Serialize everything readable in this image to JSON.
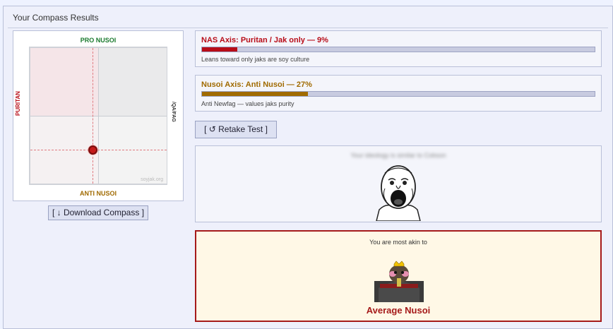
{
  "panel": {
    "title": "Your Compass Results"
  },
  "compass": {
    "top_label": "PRO NUSOI",
    "bottom_label": "ANTI NUSOI",
    "left_label": "PURITAN",
    "right_label": "/QA/FAG",
    "watermark": "soyjak.org",
    "marker_color": "#c41a1a"
  },
  "download_button": {
    "label": "[ ↓ Download Compass ]"
  },
  "nas_axis": {
    "title": "NAS Axis: Puritan / Jak only — 9%",
    "percent": 9,
    "color": "#b80d18",
    "description": "Leans toward only jaks are soy culture"
  },
  "nusoi_axis": {
    "title": "Nusoi Axis: Anti Nusoi — 27%",
    "percent": 27,
    "color": "#a06a00",
    "description": "Anti Newfag — values jaks purity"
  },
  "retake_button": {
    "label": "[ ↺ Retake Test ]"
  },
  "ideology": {
    "blurred_text": "Your ideology is similar to Cobson",
    "image_icon": "soyjak-face-icon"
  },
  "result": {
    "intro": "You are most akin to",
    "name": "Average Nusoi",
    "image_icon": "nusoi-figure-icon",
    "accent_color": "#a51a1a"
  }
}
